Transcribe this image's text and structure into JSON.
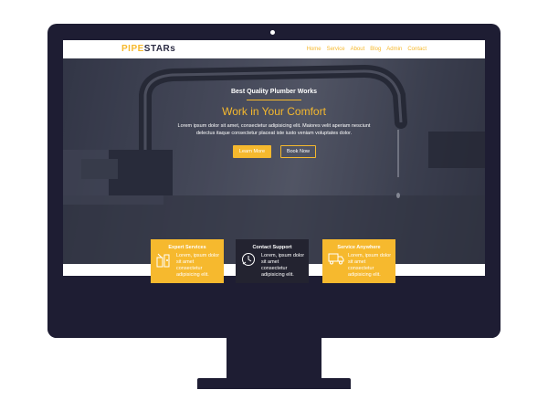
{
  "brand": {
    "logo_part1": "PIPE",
    "logo_part2": "STARs"
  },
  "nav": {
    "items": [
      "Home",
      "Service",
      "About",
      "Blog",
      "Admin",
      "Contact"
    ]
  },
  "hero": {
    "eyebrow": "Best Quality Plumber Works",
    "headline": "Work in Your Comfort",
    "description": "Lorem ipsum dolor sit amet, consectetur adipisicing elit. Maiores velit aperiam nesciunt delectus itaque consectetur placeat iste iusto veniam voluptates dolor.",
    "primary_button": "Learn More",
    "secondary_button": "Book Now"
  },
  "cards": [
    {
      "title": "Expert Services",
      "text": "Lorem, ipsum dolor sit amet consectetur adipisicing elit.",
      "icon": "tools-icon"
    },
    {
      "title": "Contact Support",
      "text": "Lorem, ipsum dolor sit amet consectetur adipisicing elit.",
      "icon": "clock-support-icon"
    },
    {
      "title": "Service Anywhere",
      "text": "Lorem, ipsum dolor sit amet consectetur adipisicing elit.",
      "icon": "truck-icon"
    }
  ],
  "colors": {
    "accent": "#f6b92e",
    "monitor": "#1e1d33",
    "dark_card": "#232330"
  }
}
